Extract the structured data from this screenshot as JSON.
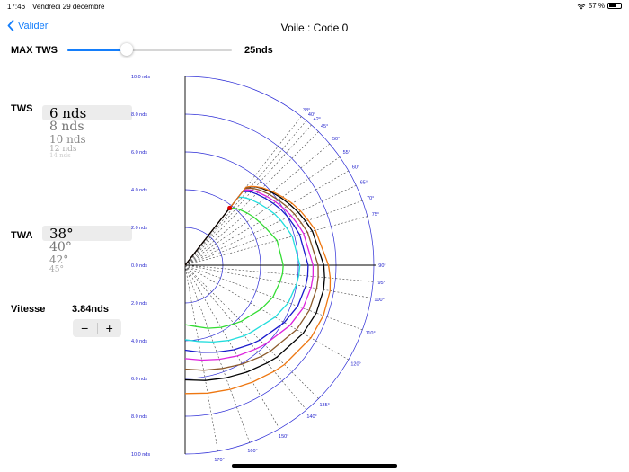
{
  "status": {
    "time": "17:46",
    "date": "Vendredi 29 décembre",
    "battery": "57 %",
    "battery_level": 0.57
  },
  "nav": {
    "back_label": "Valider",
    "title": "Voile : Code 0"
  },
  "max_tws": {
    "label": "MAX TWS",
    "value_text": "25nds",
    "slider_fraction": 0.36
  },
  "tws": {
    "label": "TWS",
    "options": [
      "6 nds",
      "8 nds",
      "10 nds",
      "12 nds",
      "14 nds"
    ],
    "selected_index": 0
  },
  "twa": {
    "label": "TWA",
    "options": [
      "38°",
      "40°",
      "42°",
      "45°"
    ],
    "selected_index": 0
  },
  "speed": {
    "label": "Vitesse",
    "value": "3.84nds",
    "minus": "−",
    "plus": "+"
  },
  "chart_data": {
    "type": "polar",
    "radial_ticks": [
      "10.0 nds",
      "8.0 nds",
      "6.0 nds",
      "4.0 nds",
      "2.0 nds",
      "0.0 nds",
      "2.0 nds",
      "4.0 nds",
      "6.0 nds",
      "8.0 nds",
      "10.0 nds"
    ],
    "rmax": 10,
    "rings": [
      2,
      4,
      6,
      8,
      10
    ],
    "angle_labels": [
      {
        "angle": 38,
        "text": "38°"
      },
      {
        "angle": 40,
        "text": "40°"
      },
      {
        "angle": 42,
        "text": "42°"
      },
      {
        "angle": 45,
        "text": "45°"
      },
      {
        "angle": 50,
        "text": "50°"
      },
      {
        "angle": 55,
        "text": "55°"
      },
      {
        "angle": 60,
        "text": "60°"
      },
      {
        "angle": 65,
        "text": "65°"
      },
      {
        "angle": 70,
        "text": "70°"
      },
      {
        "angle": 75,
        "text": "75°"
      },
      {
        "angle": 90,
        "text": "90°"
      },
      {
        "angle": 95,
        "text": "95°"
      },
      {
        "angle": 100,
        "text": "100°"
      },
      {
        "angle": 110,
        "text": "110°"
      },
      {
        "angle": 120,
        "text": "120°"
      },
      {
        "angle": 135,
        "text": "135°"
      },
      {
        "angle": 140,
        "text": "140°"
      },
      {
        "angle": 150,
        "text": "150°"
      },
      {
        "angle": 160,
        "text": "160°"
      },
      {
        "angle": 170,
        "text": "170°"
      }
    ],
    "angles": [
      38,
      40,
      42,
      45,
      50,
      55,
      60,
      65,
      70,
      75,
      90,
      95,
      100,
      110,
      120,
      135,
      140,
      150,
      160,
      170,
      180
    ],
    "series": [
      {
        "tws": 6,
        "color": "#33dd33",
        "speeds": [
          3.84,
          3.95,
          4.04,
          4.14,
          4.3,
          4.44,
          4.56,
          4.7,
          4.85,
          5.05,
          5.2,
          5.18,
          5.1,
          4.95,
          4.65,
          4.2,
          4.05,
          3.8,
          3.55,
          3.3,
          3.15
        ]
      },
      {
        "tws": 8,
        "color": "#22dddd",
        "speeds": [
          4.55,
          4.7,
          4.8,
          4.92,
          5.1,
          5.27,
          5.46,
          5.6,
          5.73,
          5.88,
          6.08,
          6.05,
          5.98,
          5.82,
          5.5,
          5.0,
          4.88,
          4.6,
          4.33,
          4.1,
          3.95
        ]
      },
      {
        "tws": 10,
        "color": "#1a1acc",
        "speeds": [
          4.95,
          5.1,
          5.22,
          5.34,
          5.53,
          5.7,
          5.88,
          6.02,
          6.14,
          6.28,
          6.52,
          6.52,
          6.48,
          6.35,
          6.07,
          5.6,
          5.45,
          5.17,
          4.9,
          4.68,
          4.5
        ]
      },
      {
        "tws": 12,
        "color": "#dd22dd",
        "speeds": [
          5.05,
          5.2,
          5.34,
          5.46,
          5.66,
          5.85,
          6.03,
          6.2,
          6.35,
          6.5,
          6.78,
          6.8,
          6.78,
          6.65,
          6.4,
          5.95,
          5.8,
          5.55,
          5.3,
          5.1,
          4.95
        ]
      },
      {
        "tws": 14,
        "color": "#8b5a2b",
        "speeds": [
          5.15,
          5.32,
          5.46,
          5.62,
          5.83,
          6.03,
          6.22,
          6.4,
          6.55,
          6.72,
          7.05,
          7.08,
          7.08,
          7.0,
          6.82,
          6.42,
          6.3,
          6.05,
          5.82,
          5.65,
          5.5
        ]
      },
      {
        "tws": 16,
        "color": "#000000",
        "speeds": [
          5.24,
          5.42,
          5.58,
          5.76,
          6.0,
          6.22,
          6.42,
          6.62,
          6.8,
          6.98,
          7.35,
          7.42,
          7.45,
          7.4,
          7.22,
          6.88,
          6.76,
          6.54,
          6.35,
          6.2,
          6.07
        ]
      },
      {
        "tws": 20,
        "color": "#ee7711",
        "speeds": [
          5.25,
          5.45,
          5.6,
          5.8,
          6.06,
          6.3,
          6.55,
          6.76,
          6.95,
          7.15,
          7.6,
          7.72,
          7.8,
          7.8,
          7.7,
          7.44,
          7.34,
          7.15,
          7.0,
          6.88,
          6.8
        ]
      }
    ],
    "marker": {
      "angle": 38,
      "speed": 3.84,
      "color": "#dd0000"
    }
  }
}
